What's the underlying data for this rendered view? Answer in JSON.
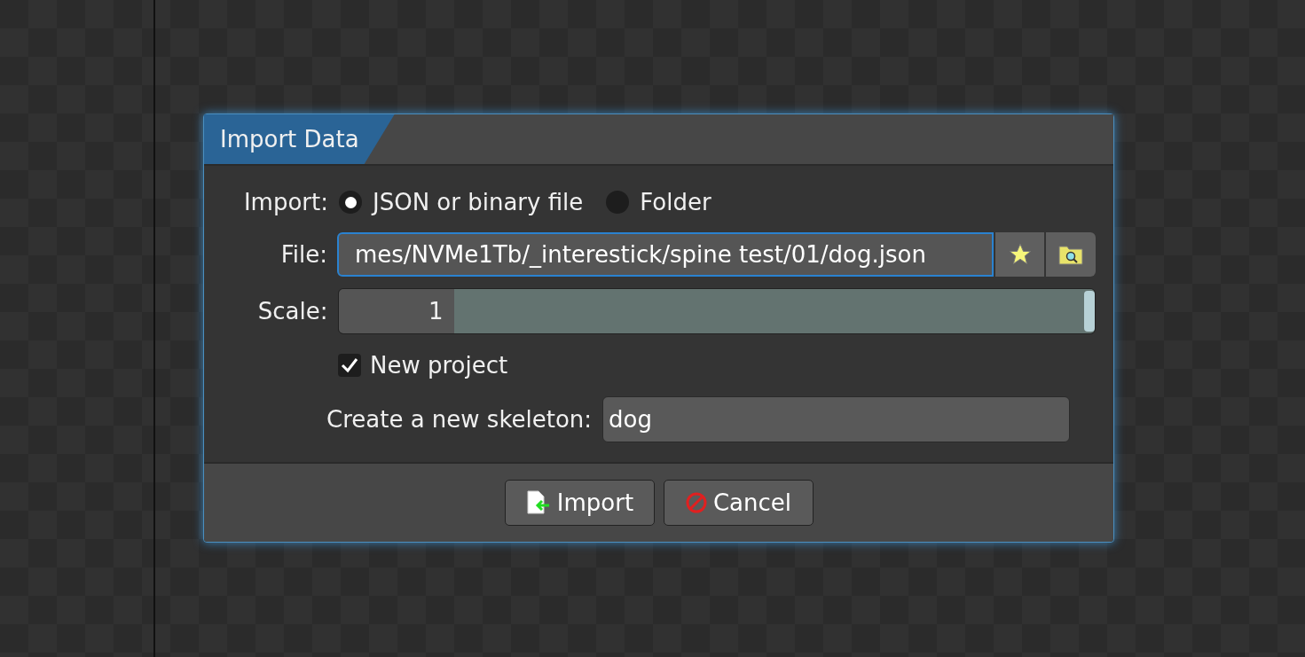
{
  "dialog": {
    "title": "Import Data",
    "import": {
      "label": "Import:",
      "options": [
        {
          "label": "JSON or binary file",
          "selected": true
        },
        {
          "label": "Folder",
          "selected": false
        }
      ]
    },
    "file": {
      "label": "File:",
      "value": "mes/NVMe1Tb/_interestick/spine test/01/dog.json"
    },
    "scale": {
      "label": "Scale:",
      "value": "1",
      "level": 1
    },
    "new_project": {
      "label": "New project",
      "checked": true
    },
    "skeleton": {
      "label": "Create a new skeleton:",
      "value": "dog"
    },
    "buttons": [
      {
        "kind": "import",
        "label": "Import"
      },
      {
        "kind": "cancel",
        "label": "Cancel"
      }
    ]
  }
}
